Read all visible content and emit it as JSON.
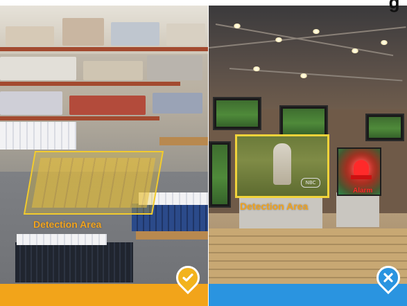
{
  "header": {
    "partial_heading": "g"
  },
  "left_panel": {
    "detection_label": "Detection Area"
  },
  "right_panel": {
    "detection_label": "Detection Area",
    "alarm_label": "Alarm",
    "tv_logo": "NBC"
  },
  "icons": {
    "left_pin": "check-icon",
    "right_pin": "x-icon"
  },
  "colors": {
    "accent_left": "#f2a41a",
    "accent_right": "#2a94e0",
    "detection_outline": "#f2cb2d",
    "detection_text": "#f1a31e",
    "alarm_text": "#ff2a2a"
  }
}
